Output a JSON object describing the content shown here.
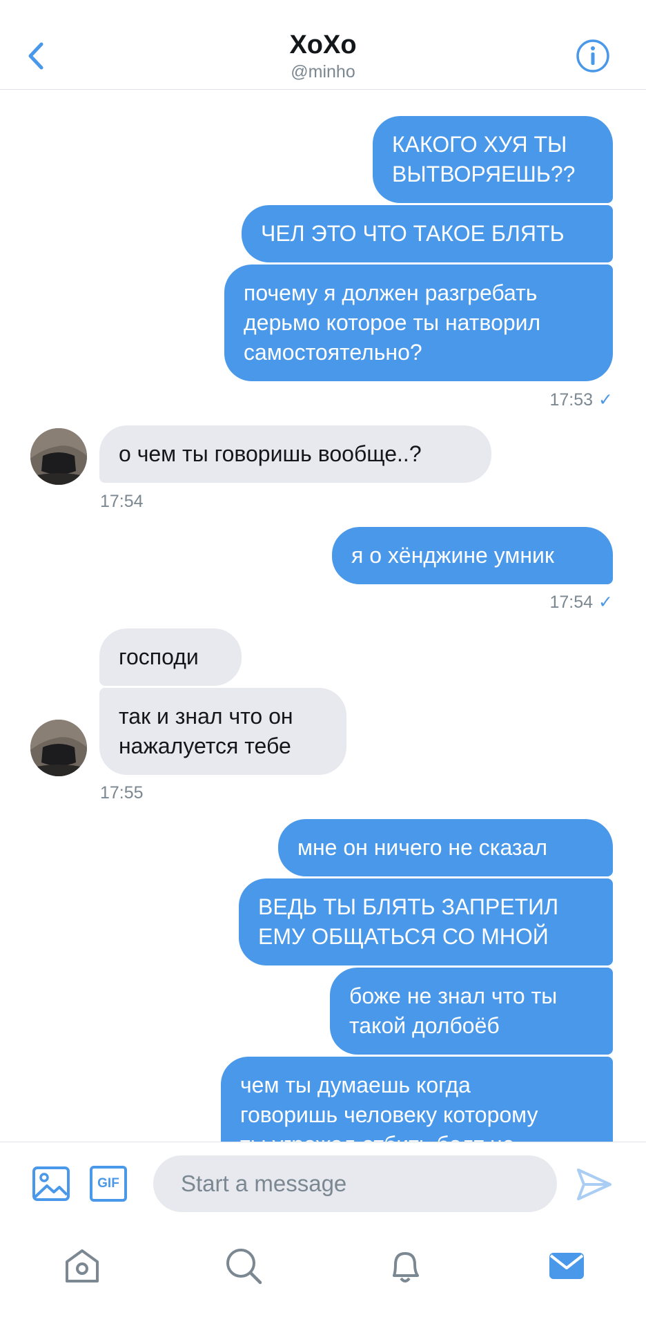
{
  "header": {
    "title": "XoXo",
    "handle": "@minho",
    "back_icon": "chevron-left-icon",
    "info_icon": "info-icon"
  },
  "colors": {
    "accent": "#4a98ea",
    "incoming_bubble": "#e7e9ef",
    "meta_text": "#7b8791"
  },
  "messages": [
    {
      "dir": "out",
      "text": "КАКОГО ХУЯ ТЫ\nВЫТВОРЯЕШЬ??"
    },
    {
      "dir": "out",
      "text": "ЧЕЛ ЭТО ЧТО ТАКОЕ БЛЯТЬ"
    },
    {
      "dir": "out",
      "text": "почему я должен разгребать\nдерьмо которое ты натворил\nсамостоятельно?"
    },
    {
      "dir": "out_time",
      "time": "17:53",
      "check": "✓"
    },
    {
      "dir": "in",
      "text": "о чем ты говоришь вообще..?"
    },
    {
      "dir": "in_time",
      "time": "17:54"
    },
    {
      "dir": "out",
      "text": "я о хёнджине умник"
    },
    {
      "dir": "out_time",
      "time": "17:54",
      "check": "✓"
    },
    {
      "dir": "in",
      "text": "господи"
    },
    {
      "dir": "in",
      "text": "так и знал что он\nнажалуется тебе"
    },
    {
      "dir": "in_time",
      "time": "17:55"
    },
    {
      "dir": "out",
      "text": "мне он ничего не сказал"
    },
    {
      "dir": "out",
      "text": "ВЕДЬ ТЫ БЛЯТЬ ЗАПРЕТИЛ\nЕМУ ОБЩАТЬСЯ СО МНОЙ"
    },
    {
      "dir": "out",
      "text": "боже не знал что ты\nтакой долбоёб"
    },
    {
      "dir": "out",
      "text": "чем ты думаешь когда\nговоришь человеку которому\nты угрожал отбить болт не"
    }
  ],
  "composer": {
    "placeholder": "Start a message",
    "gif_label": "GIF",
    "media_icon": "image-icon",
    "send_icon": "send-icon"
  },
  "tabs": [
    {
      "name": "home",
      "icon": "home-icon"
    },
    {
      "name": "search",
      "icon": "search-icon"
    },
    {
      "name": "notifications",
      "icon": "bell-icon"
    },
    {
      "name": "messages",
      "icon": "mail-icon",
      "active": true
    }
  ]
}
